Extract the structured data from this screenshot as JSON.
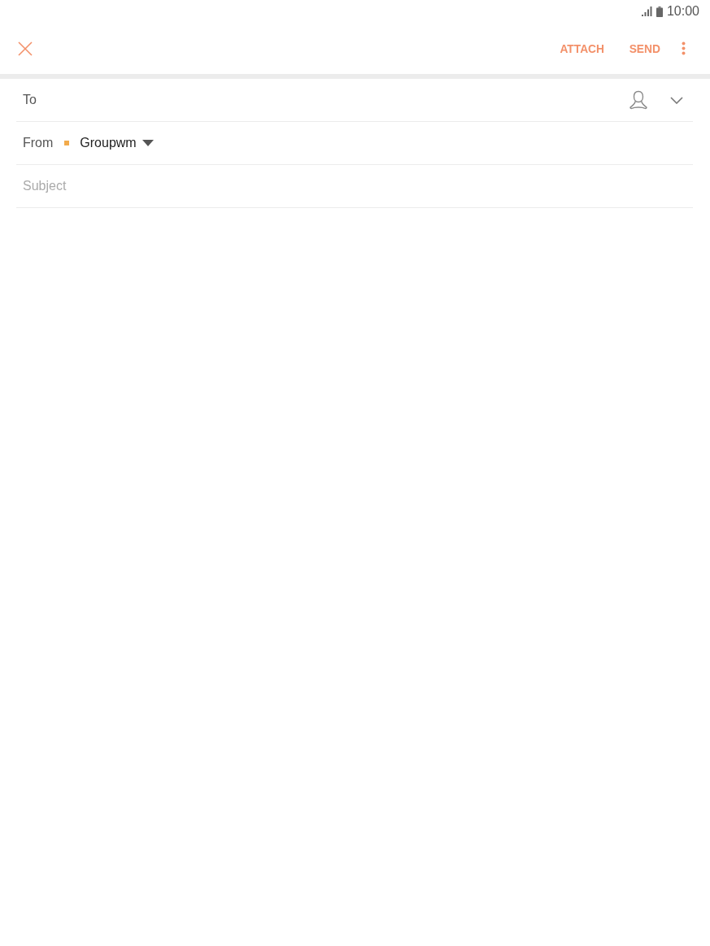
{
  "status_bar": {
    "time": "10:00"
  },
  "toolbar": {
    "actions": [
      {
        "label": "ATTACH"
      },
      {
        "label": "SEND"
      }
    ]
  },
  "fields": [
    {
      "kind": "recipient",
      "label": "To"
    },
    {
      "kind": "account",
      "label": "From",
      "value": "Groupwm",
      "color": "#f2ab4c"
    },
    {
      "kind": "text",
      "placeholder": "Subject"
    }
  ]
}
